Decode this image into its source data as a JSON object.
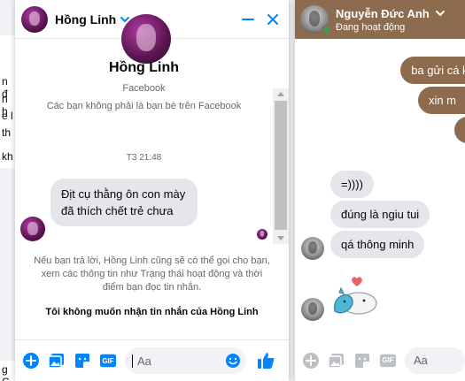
{
  "background": {
    "fragments": [
      "n đ",
      "n h",
      "e l",
      "th",
      "kh"
    ],
    "bottom_fragment": "g C"
  },
  "chat1": {
    "header": {
      "name": "Hồng Linh"
    },
    "profile": {
      "name": "Hồng Linh",
      "subtitle": "Facebook",
      "note": "Các bạn không phải là bạn bè trên Facebook"
    },
    "timestamp": "T3 21:48",
    "messages": [
      {
        "direction": "incoming",
        "text": "Địt cụ thằng ôn con mày đã thích chết trẻ chưa"
      }
    ],
    "notice": "Nếu bạn trả lời, Hồng Linh cũng sẽ có thể gọi cho bạn, xem các thông tin như Trạng thái hoạt động và thời điểm bạn đọc tin nhắn.",
    "notice_action": "Tôi không muốn nhận tin nhắn của Hồng Linh",
    "composer": {
      "placeholder": "Aa",
      "gif_label": "GIF"
    }
  },
  "chat2": {
    "header": {
      "name": "Nguyễn Đức Anh",
      "status": "Đang hoạt động"
    },
    "messages_outgoing": [
      "ba gửi cá khô",
      "xin m",
      ""
    ],
    "messages_incoming": [
      "=))))",
      "đúng là ngiu tui",
      "qá thông minh"
    ],
    "composer": {
      "placeholder": "Aa",
      "gif_label": "GIF"
    }
  },
  "colors": {
    "messenger_blue": "#0084ff",
    "chat2_theme": "#8c6b4f",
    "bubble_gray": "#e4e6eb",
    "secondary_text": "#65676b",
    "online_green": "#31a24c"
  }
}
